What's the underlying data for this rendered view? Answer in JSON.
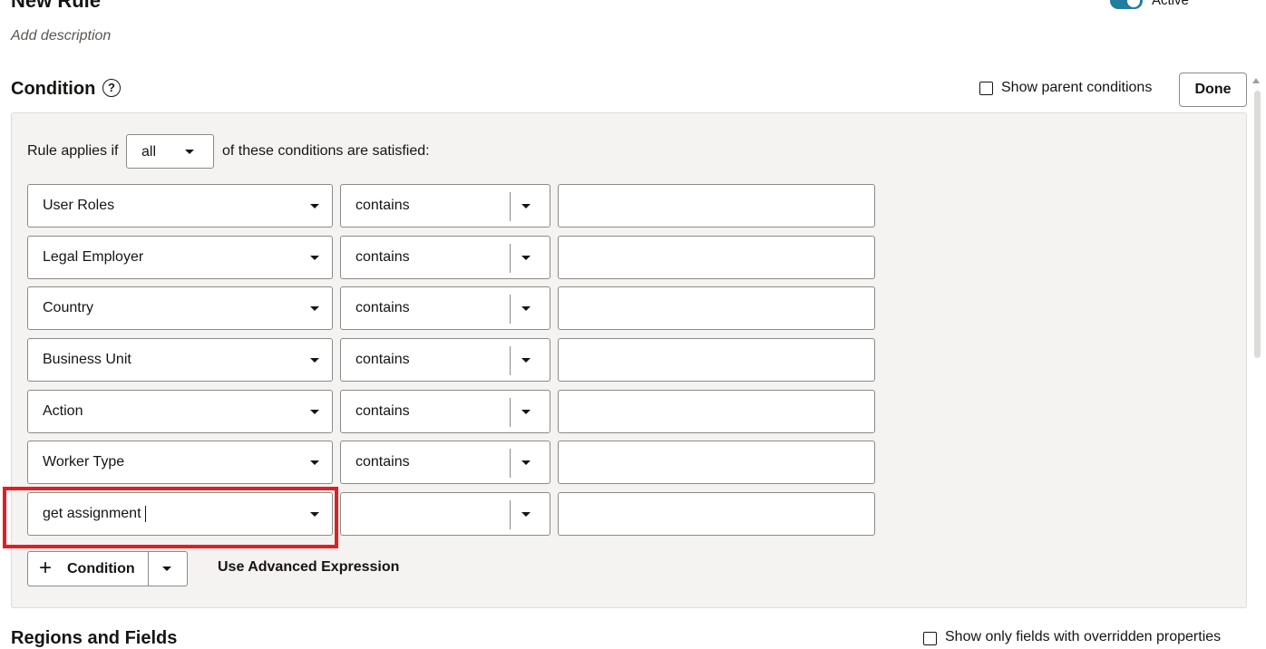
{
  "header": {
    "title": "New Rule",
    "description_placeholder": "Add description",
    "active_label": "Active",
    "active_on": true,
    "more_icon": "more-horizontal-icon"
  },
  "condition": {
    "title": "Condition",
    "help_icon": "question-circle-icon",
    "show_parent_label": "Show parent conditions",
    "done_label": "Done",
    "applies_prefix": "Rule applies if",
    "applies_value": "all",
    "applies_suffix": "of these conditions are satisfied:",
    "rows": [
      {
        "field": "User Roles",
        "operator": "contains",
        "value": ""
      },
      {
        "field": "Legal Employer",
        "operator": "contains",
        "value": ""
      },
      {
        "field": "Country",
        "operator": "contains",
        "value": ""
      },
      {
        "field": "Business Unit",
        "operator": "contains",
        "value": ""
      },
      {
        "field": "Action",
        "operator": "contains",
        "value": ""
      },
      {
        "field": "Worker Type",
        "operator": "contains",
        "value": ""
      },
      {
        "field": "get assignment",
        "operator": "",
        "value": ""
      }
    ],
    "add_condition_label": "Condition",
    "advanced_label": "Use Advanced Expression",
    "highlight_color": "#e01e26"
  },
  "regions": {
    "title": "Regions and Fields",
    "show_overridden_label": "Show only fields with overridden properties"
  }
}
